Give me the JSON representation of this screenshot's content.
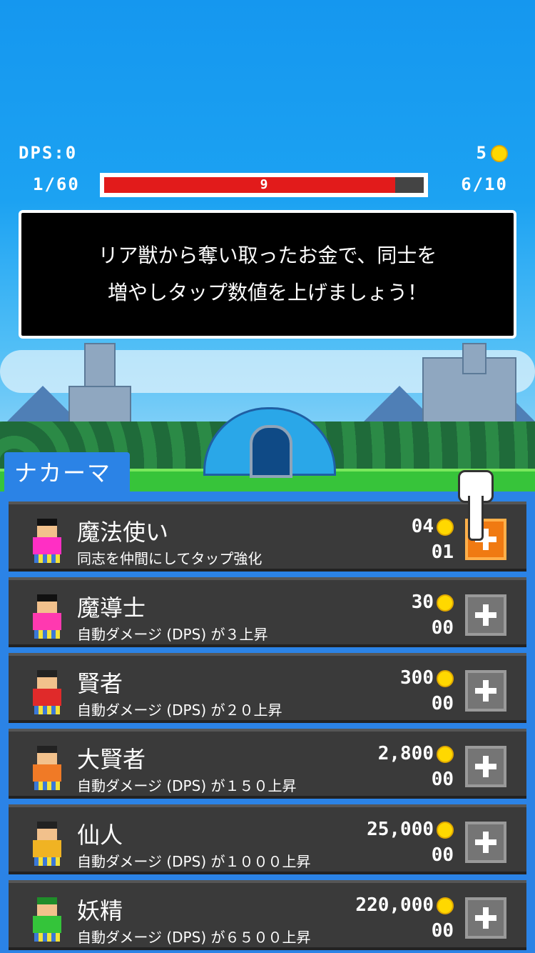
{
  "hud": {
    "dps": "DPS:0",
    "coins": "5",
    "stage": "1/60",
    "wave": "6/10",
    "hp_value": "9",
    "hp_fraction": 0.91
  },
  "dialog": {
    "line1": "リア獣から奪い取ったお金で、同士を",
    "line2": "増やしタップ数値を上げましょう！"
  },
  "tab": {
    "label": "ナカーマ"
  },
  "units": [
    {
      "name": "魔法使い",
      "desc": "同志を仲間にしてタップ強化",
      "cost": "04",
      "level": "01",
      "active": true,
      "color": "#ff2fc4",
      "hair": "#111"
    },
    {
      "name": "魔導士",
      "desc": "自動ダメージ (DPS) が３上昇",
      "cost": "30",
      "level": "00",
      "active": false,
      "color": "#ff39b0",
      "hair": "#111"
    },
    {
      "name": "賢者",
      "desc": "自動ダメージ (DPS) が２０上昇",
      "cost": "300",
      "level": "00",
      "active": false,
      "color": "#e02a2a",
      "hair": "#222"
    },
    {
      "name": "大賢者",
      "desc": "自動ダメージ (DPS) が１５０上昇",
      "cost": "2,800",
      "level": "00",
      "active": false,
      "color": "#f07a26",
      "hair": "#222"
    },
    {
      "name": "仙人",
      "desc": "自動ダメージ (DPS) が１０００上昇",
      "cost": "25,000",
      "level": "00",
      "active": false,
      "color": "#f0b323",
      "hair": "#222"
    },
    {
      "name": "妖精",
      "desc": "自動ダメージ (DPS) が６５００上昇",
      "cost": "220,000",
      "level": "00",
      "active": false,
      "color": "#34c43a",
      "hair": "#1f8d2a"
    }
  ]
}
